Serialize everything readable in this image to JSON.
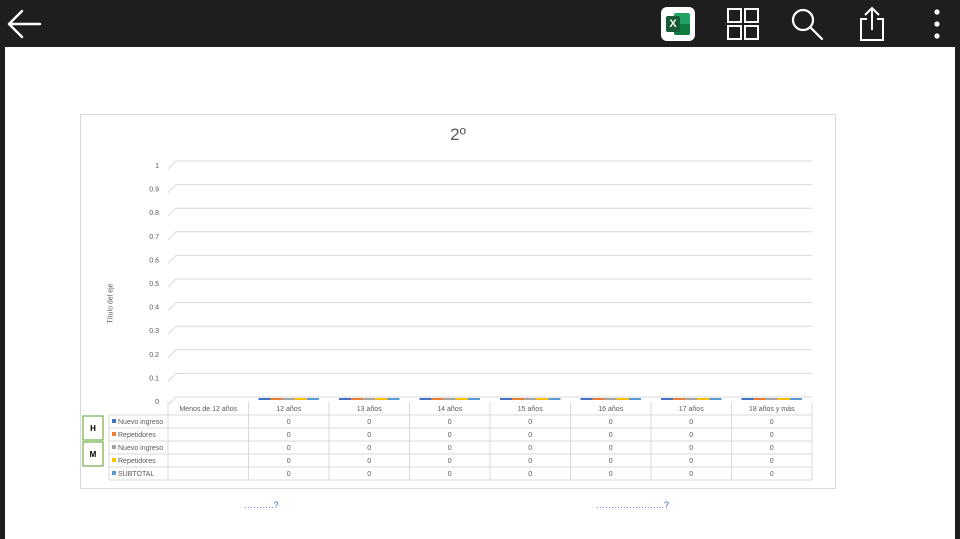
{
  "toolbar": {
    "back_icon": "back-arrow-icon",
    "excel_icon": "excel-icon",
    "excel_letter": "X",
    "grid_icon": "grid-view-icon",
    "search_icon": "search-icon",
    "share_icon": "share-icon",
    "more_icon": "more-vertical-icon"
  },
  "colors": {
    "nuevo_ingreso": "#4472c4",
    "repetidores": "#ed7d31",
    "nuevo_ingreso_m": "#a5a5a5",
    "repetidores_m": "#ffc000",
    "subtotal": "#5b9bd5"
  },
  "chart_data": {
    "type": "bar",
    "title": "2º",
    "ylabel": "Título del eje",
    "ylim": [
      0,
      1
    ],
    "yticks": [
      "0",
      "0.1",
      "0.2",
      "0.3",
      "0.4",
      "0.5",
      "0.6",
      "0.7",
      "0.8",
      "0.9",
      "1"
    ],
    "categories": [
      "Menos de 12 años",
      "12 años",
      "13 años",
      "14 años",
      "15 años",
      "16 años",
      "17 años",
      "18 años y más"
    ],
    "series": [
      {
        "name": "Nuevo ingreso",
        "group": "H",
        "values": [
          null,
          0,
          0,
          0,
          0,
          0,
          0,
          0
        ]
      },
      {
        "name": "Repetidores",
        "group": "H",
        "values": [
          null,
          0,
          0,
          0,
          0,
          0,
          0,
          0
        ]
      },
      {
        "name": "Nuevo ingreso",
        "group": "M",
        "values": [
          null,
          0,
          0,
          0,
          0,
          0,
          0,
          0
        ]
      },
      {
        "name": "Repetidores",
        "group": "M",
        "values": [
          null,
          0,
          0,
          0,
          0,
          0,
          0,
          0
        ]
      },
      {
        "name": "SUBTOTAL",
        "group": "",
        "values": [
          null,
          0,
          0,
          0,
          0,
          0,
          0,
          0
        ]
      }
    ],
    "row_groups": [
      "H",
      "M"
    ]
  },
  "footer": {
    "link_left": "……….?",
    "link_right": "…………………..?"
  }
}
